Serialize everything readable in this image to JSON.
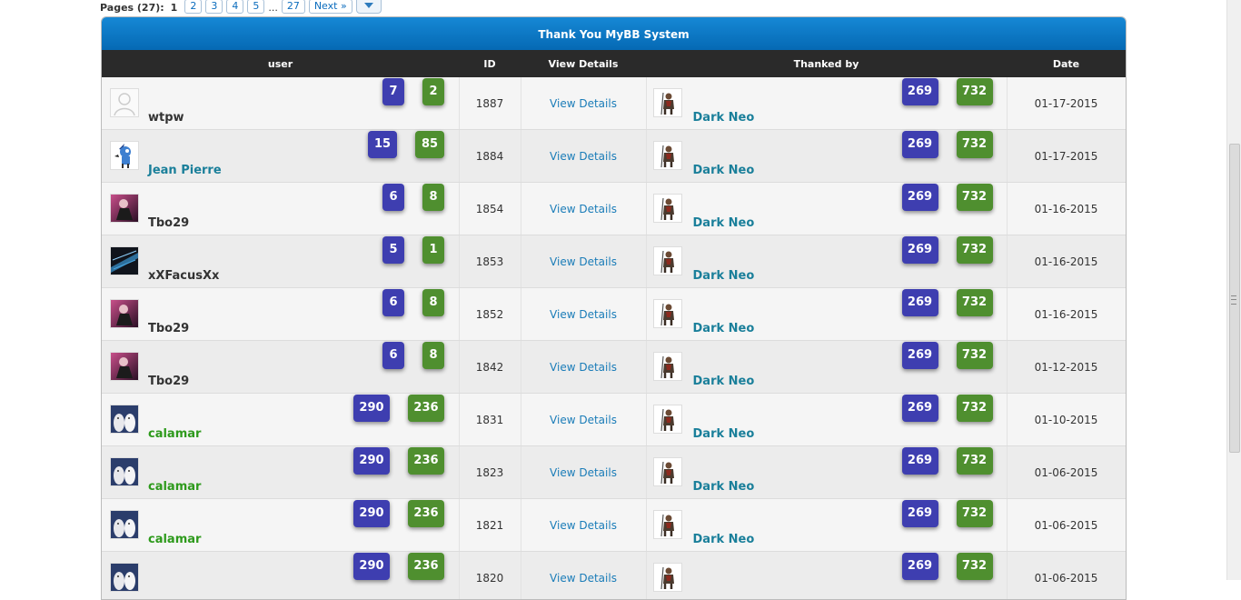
{
  "pager": {
    "label": "Pages (27):",
    "current": "1",
    "pages": [
      "2",
      "3",
      "4",
      "5"
    ],
    "ellipsis": "...",
    "last": "27",
    "next": "Next »"
  },
  "table": {
    "title": "Thank You MyBB System",
    "columns": {
      "user": "user",
      "id": "ID",
      "details": "View Details",
      "thanked": "Thanked by",
      "date": "Date"
    },
    "rows": [
      {
        "user": "wtpw",
        "user_color": "#333333",
        "b1": "7",
        "b2": "2",
        "id": "1887",
        "details": "View Details",
        "thanked_by": "Dark Neo",
        "t1": "269",
        "t2": "732",
        "date": "01-17-2015"
      },
      {
        "user": "Jean Pierre",
        "user_color": "#1a7f9a",
        "b1": "15",
        "b2": "85",
        "id": "1884",
        "details": "View Details",
        "thanked_by": "Dark Neo",
        "t1": "269",
        "t2": "732",
        "date": "01-17-2015"
      },
      {
        "user": "Tbo29",
        "user_color": "#333333",
        "b1": "6",
        "b2": "8",
        "id": "1854",
        "details": "View Details",
        "thanked_by": "Dark Neo",
        "t1": "269",
        "t2": "732",
        "date": "01-16-2015"
      },
      {
        "user": "xXFacusXx",
        "user_color": "#333333",
        "b1": "5",
        "b2": "1",
        "id": "1853",
        "details": "View Details",
        "thanked_by": "Dark Neo",
        "t1": "269",
        "t2": "732",
        "date": "01-16-2015"
      },
      {
        "user": "Tbo29",
        "user_color": "#333333",
        "b1": "6",
        "b2": "8",
        "id": "1852",
        "details": "View Details",
        "thanked_by": "Dark Neo",
        "t1": "269",
        "t2": "732",
        "date": "01-16-2015"
      },
      {
        "user": "Tbo29",
        "user_color": "#333333",
        "b1": "6",
        "b2": "8",
        "id": "1842",
        "details": "View Details",
        "thanked_by": "Dark Neo",
        "t1": "269",
        "t2": "732",
        "date": "01-12-2015"
      },
      {
        "user": "calamar",
        "user_color": "#2e9a1c",
        "b1": "290",
        "b2": "236",
        "id": "1831",
        "details": "View Details",
        "thanked_by": "Dark Neo",
        "t1": "269",
        "t2": "732",
        "date": "01-10-2015"
      },
      {
        "user": "calamar",
        "user_color": "#2e9a1c",
        "b1": "290",
        "b2": "236",
        "id": "1823",
        "details": "View Details",
        "thanked_by": "Dark Neo",
        "t1": "269",
        "t2": "732",
        "date": "01-06-2015"
      },
      {
        "user": "calamar",
        "user_color": "#2e9a1c",
        "b1": "290",
        "b2": "236",
        "id": "1821",
        "details": "View Details",
        "thanked_by": "Dark Neo",
        "t1": "269",
        "t2": "732",
        "date": "01-06-2015"
      },
      {
        "user": "",
        "user_color": "#2e9a1c",
        "b1": "290",
        "b2": "236",
        "id": "1820",
        "details": "View Details",
        "thanked_by": "",
        "t1": "269",
        "t2": "732",
        "date": "01-06-2015"
      }
    ]
  },
  "colors": {
    "header_blue": "#0b78c6",
    "badge_blue": "#3e3eb0",
    "badge_green": "#4f8f2f",
    "link_teal": "#1a7f9a",
    "link_blue": "#1a7cb8"
  }
}
